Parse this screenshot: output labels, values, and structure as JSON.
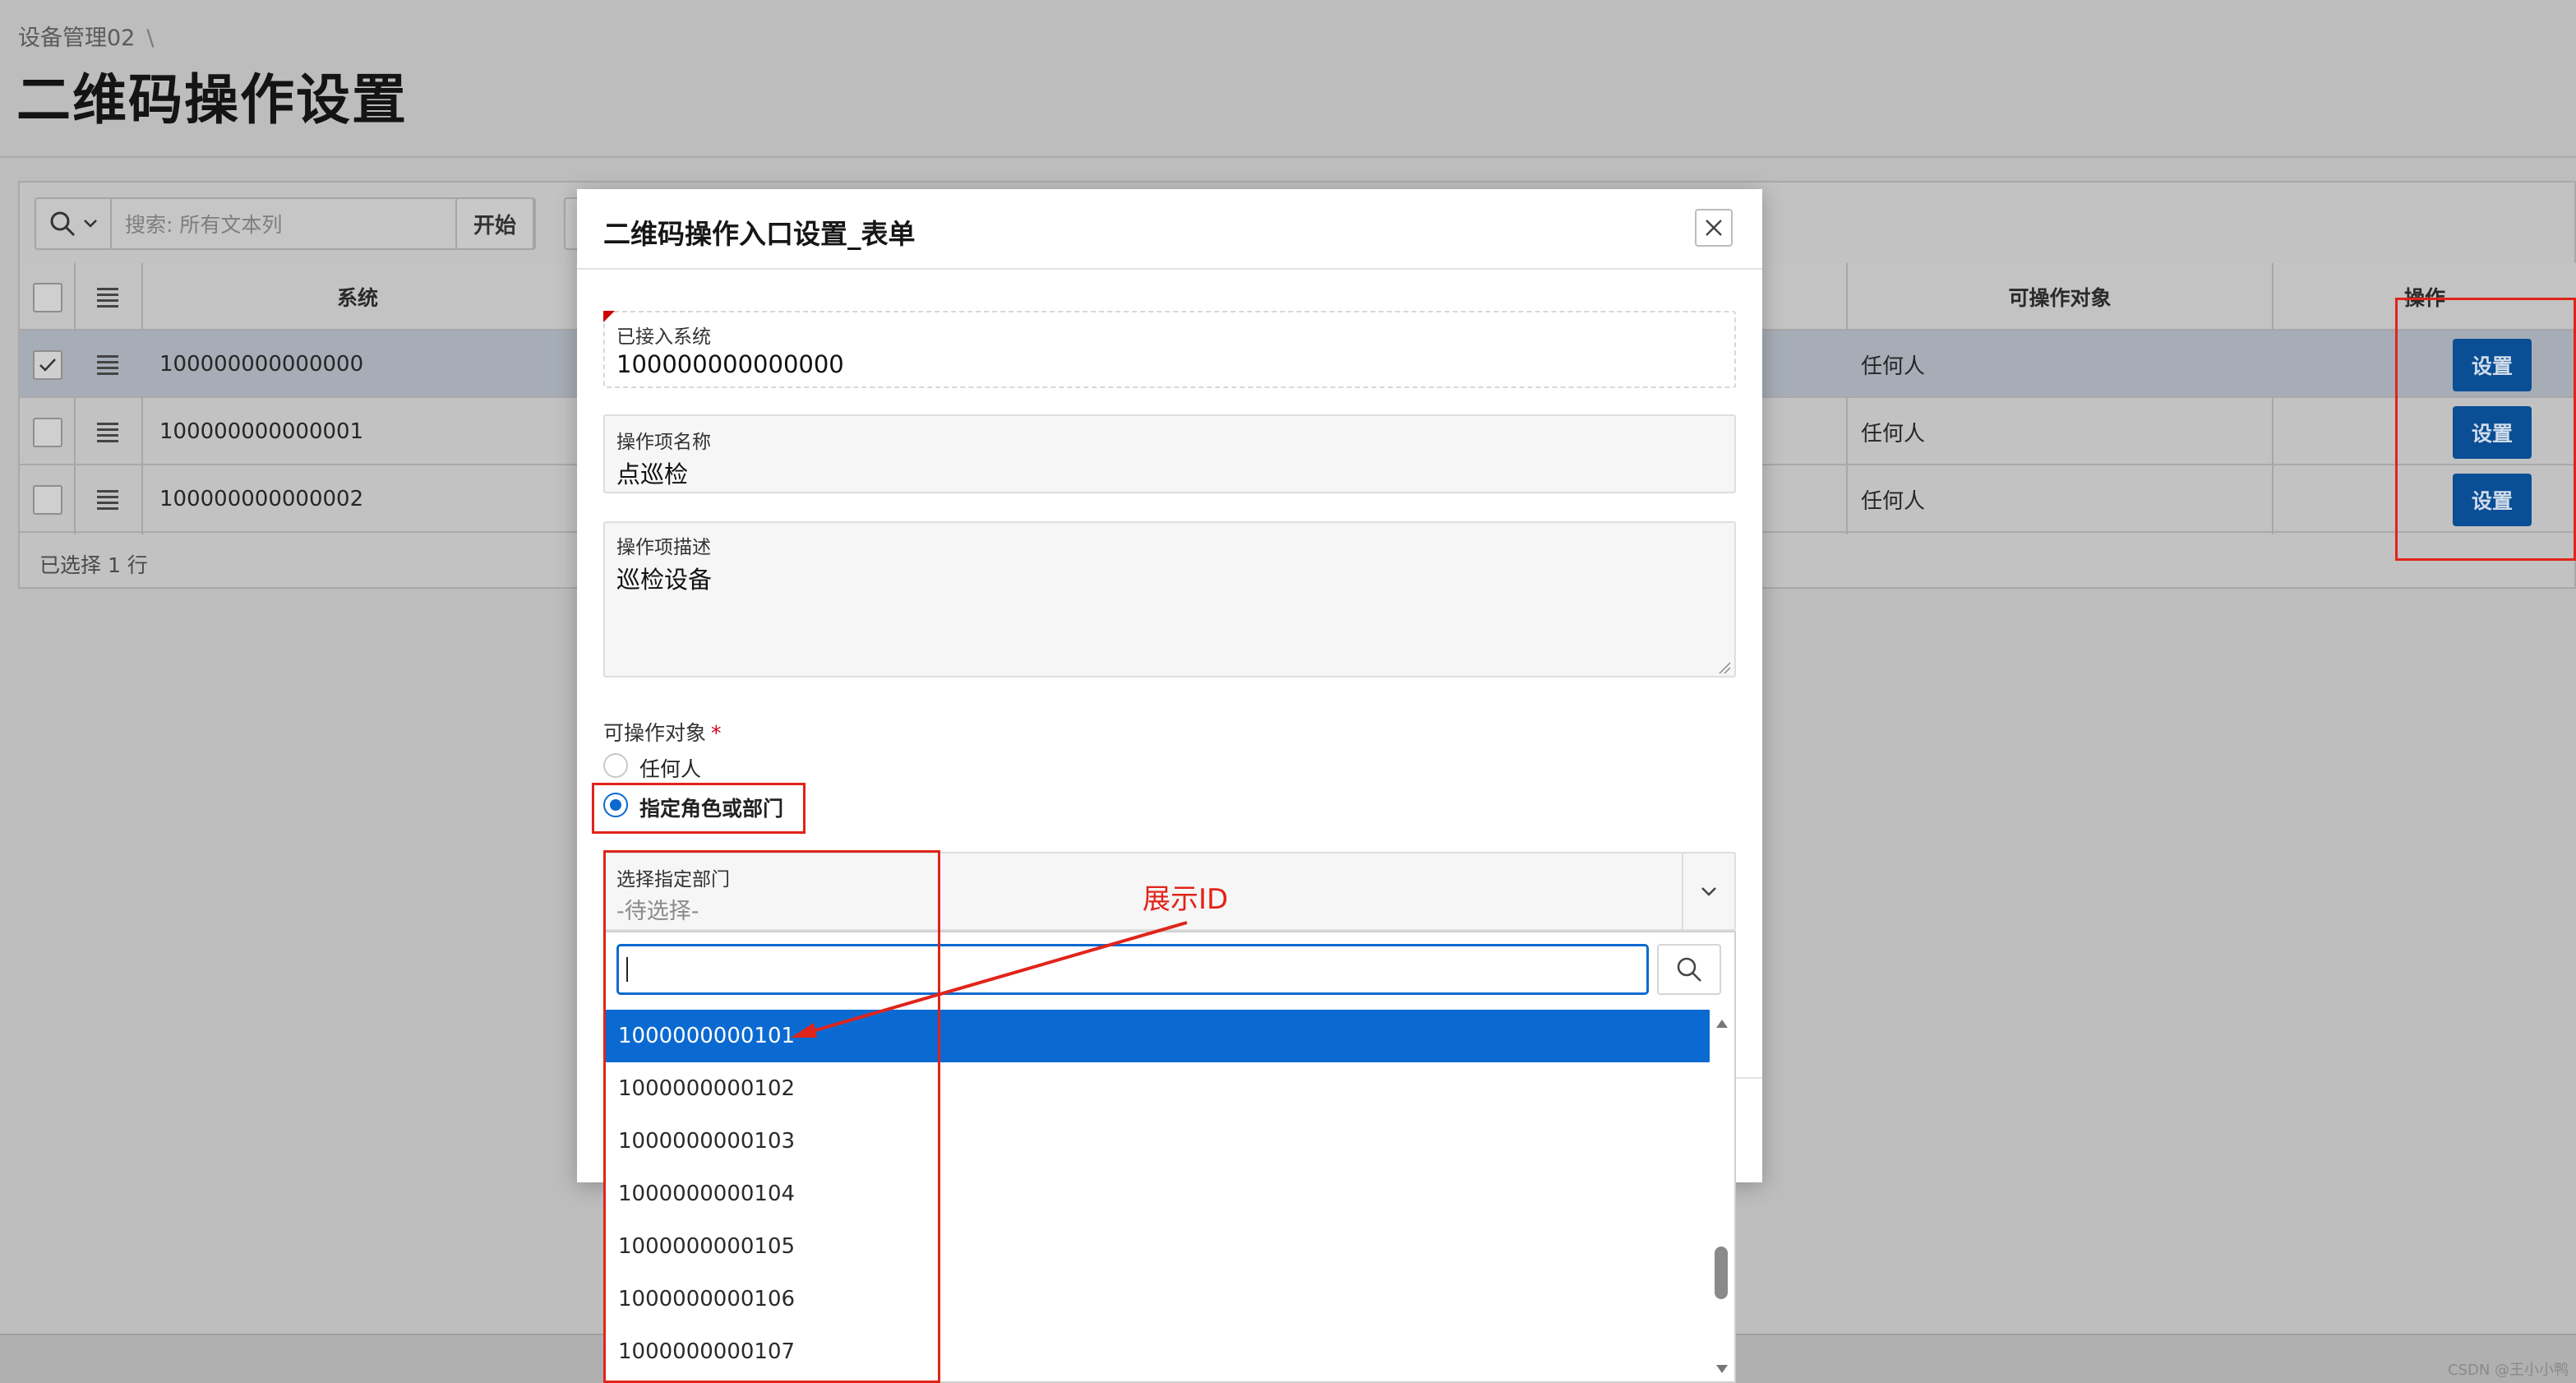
{
  "page": {
    "breadcrumb": "设备管理02",
    "breadcrumb_sep": "\\",
    "title": "二维码操作设置"
  },
  "toolbar": {
    "search_placeholder": "搜索: 所有文本列",
    "go_label": "开始"
  },
  "table": {
    "columns": [
      "系统",
      "可操作对象",
      "操作"
    ],
    "rows": [
      {
        "system": "100000000000000",
        "target": "任何人",
        "action": "设置",
        "selected": true
      },
      {
        "system": "100000000000001",
        "target": "任何人",
        "action": "设置",
        "selected": false
      },
      {
        "system": "100000000000002",
        "target": "任何人",
        "action": "设置",
        "selected": false
      }
    ],
    "selected_count_text": "已选择 1 行"
  },
  "dialog": {
    "title": "二维码操作入口设置_表单",
    "fields": {
      "system_label": "已接入系统",
      "system_value": "100000000000000",
      "name_label": "操作项名称",
      "name_value": "点巡检",
      "desc_label": "操作项描述",
      "desc_value": "巡检设备"
    },
    "target": {
      "label": "可操作对象",
      "required_mark": "*",
      "options": [
        "任何人",
        "指定角色或部门"
      ],
      "selected": "指定角色或部门"
    },
    "dept_select": {
      "label": "选择指定部门",
      "placeholder": "-待选择-",
      "search_value": "",
      "options": [
        "1000000000101",
        "1000000000102",
        "1000000000103",
        "1000000000104",
        "1000000000105",
        "1000000000106",
        "1000000000107"
      ],
      "highlighted": "1000000000101"
    }
  },
  "annotation": {
    "text": "展示ID",
    "color": "#e0241b"
  },
  "watermark": "CSDN @王小小鸭",
  "colors": {
    "accent": "#0b6ad1",
    "button": "#0a4e95",
    "annotation": "#e0241b"
  }
}
